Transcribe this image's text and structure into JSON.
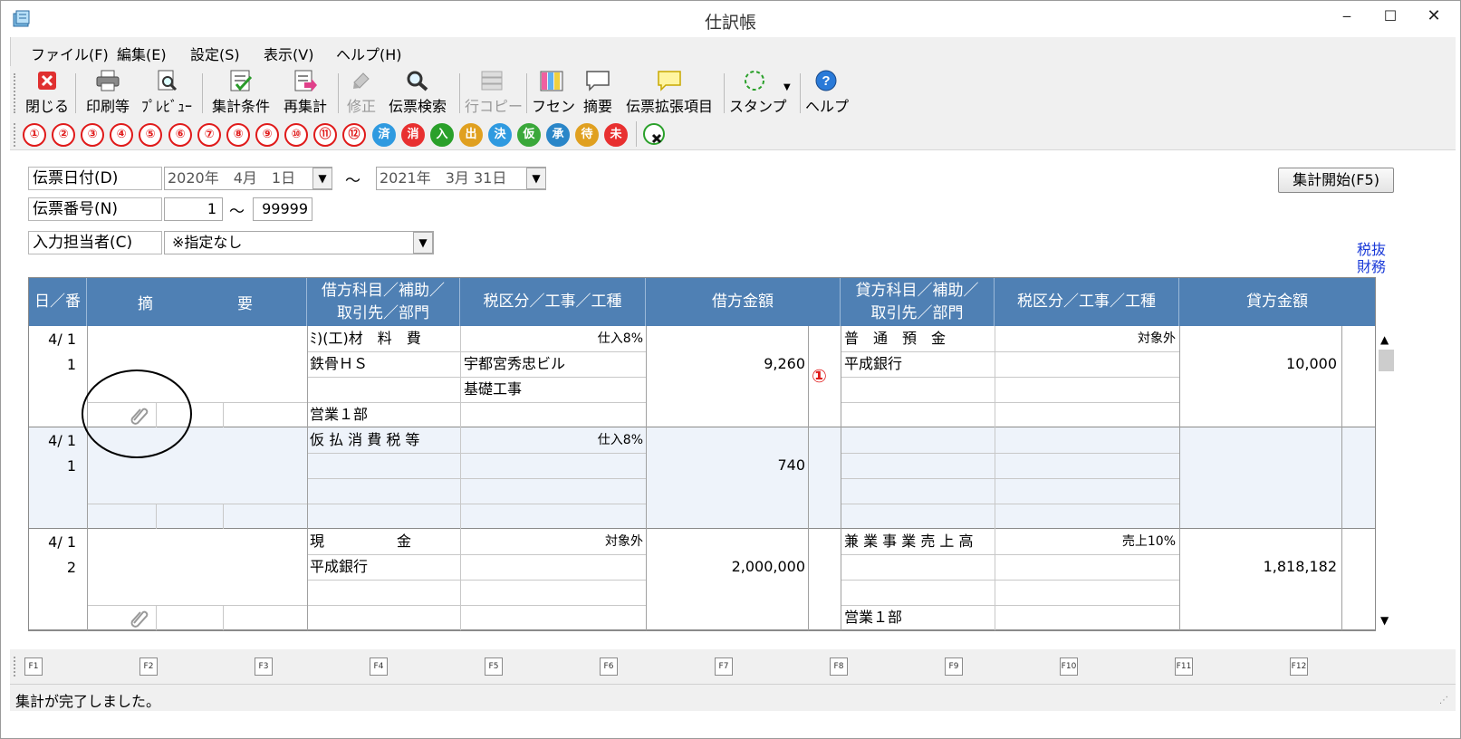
{
  "window": {
    "title": "仕訳帳",
    "controls": {
      "minimize": "‒",
      "maximize": "☐",
      "close": "✕"
    }
  },
  "menu": [
    {
      "label": "ファイル(F)"
    },
    {
      "label": "編集(E)"
    },
    {
      "label": "設定(S)"
    },
    {
      "label": "表示(V)"
    },
    {
      "label": "ヘルプ(H)"
    }
  ],
  "toolbar": [
    {
      "label": "閉じる",
      "icon": "close-icon"
    },
    {
      "label": "印刷等",
      "icon": "printer-icon"
    },
    {
      "label": "ﾌﾟﾚﾋﾞｭｰ",
      "icon": "preview-icon"
    },
    {
      "label": "集計条件",
      "icon": "conditions-icon"
    },
    {
      "label": "再集計",
      "icon": "recalc-icon"
    },
    {
      "label": "修正",
      "icon": "edit-icon"
    },
    {
      "label": "伝票検索",
      "icon": "search-icon"
    },
    {
      "label": "行コピー",
      "icon": "copy-row-icon"
    },
    {
      "label": "フセン",
      "icon": "sticky-note-icon"
    },
    {
      "label": "摘要",
      "icon": "memo-icon"
    },
    {
      "label": "伝票拡張項目",
      "icon": "extended-items-icon"
    },
    {
      "label": "スタンプ",
      "icon": "stamp-icon"
    },
    {
      "label": "ヘルプ",
      "icon": "help-icon"
    }
  ],
  "circle_buttons": [
    "①",
    "②",
    "③",
    "④",
    "⑤",
    "⑥",
    "⑦",
    "⑧",
    "⑨",
    "⑩",
    "⑪",
    "⑫",
    "済",
    "消",
    "入",
    "出",
    "決",
    "仮",
    "承",
    "待",
    "未"
  ],
  "circle_colors": {
    "済": "#2f9ae0",
    "消": "#e83030",
    "入": "#2aa02a",
    "出": "#e0a020",
    "決": "#2f9ae0",
    "仮": "#3aa83a",
    "承": "#2a86c8",
    "待": "#e0a020",
    "未": "#e83030"
  },
  "filters": {
    "date_label": "伝票日付(D)",
    "date_from": "2020年　4月　1日",
    "date_to": "2021年　3月 31日",
    "range_sep": "〜",
    "number_label": "伝票番号(N)",
    "number_from": "1",
    "number_to": "99999",
    "user_label": "入力担当者(C)",
    "user_value": "※指定なし",
    "start_button": "集計開始(F5)",
    "tax_link_1": "税抜",
    "tax_link_2": "財務"
  },
  "grid": {
    "headers": {
      "date_no": "日／番",
      "summary_1": "摘",
      "summary_2": "要",
      "debit_account_1": "借方科目／補助／",
      "debit_account_2": "取引先／部門",
      "debit_tax": "税区分／工事／工種",
      "debit_amount": "借方金額",
      "credit_account_1": "貸方科目／補助／",
      "credit_account_2": "取引先／部門",
      "credit_tax": "税区分／工事／工種",
      "credit_amount": "貸方金額"
    },
    "rows": [
      {
        "date": "4/ 1",
        "no": "1",
        "debit_account": "ﾐ)(工)材　料　費",
        "debit_sub": "鉄骨ＨＳ",
        "debit_dept": "営業１部",
        "debit_tax": "仕入8%",
        "debit_project": "宇都宮秀忠ビル",
        "debit_work": "基礎工事",
        "debit_amount": "9,260",
        "mark": "①",
        "credit_account": "普　通　預　金",
        "credit_sub": "平成銀行",
        "credit_dept": "",
        "credit_tax": "対象外",
        "credit_amount": "10,000"
      },
      {
        "date": "4/ 1",
        "no": "1",
        "debit_account": "仮 払 消 費 税 等",
        "debit_sub": "",
        "debit_dept": "",
        "debit_tax": "仕入8%",
        "debit_project": "",
        "debit_work": "",
        "debit_amount": "740",
        "mark": "",
        "credit_account": "",
        "credit_sub": "",
        "credit_dept": "",
        "credit_tax": "",
        "credit_amount": ""
      },
      {
        "date": "4/ 1",
        "no": "2",
        "debit_account": "現　　　　　金",
        "debit_sub": "平成銀行",
        "debit_dept": "",
        "debit_tax": "対象外",
        "debit_project": "",
        "debit_work": "",
        "debit_amount": "2,000,000",
        "mark": "",
        "credit_account": "兼 業 事 業 売 上 高",
        "credit_sub": "",
        "credit_dept": "営業１部",
        "credit_tax": "売上10%",
        "credit_amount": "1,818,182"
      }
    ]
  },
  "function_keys": [
    "F1",
    "F2",
    "F3",
    "F4",
    "F5",
    "F6",
    "F7",
    "F8",
    "F9",
    "F10",
    "F11",
    "F12"
  ],
  "status": "集計が完了しました。"
}
